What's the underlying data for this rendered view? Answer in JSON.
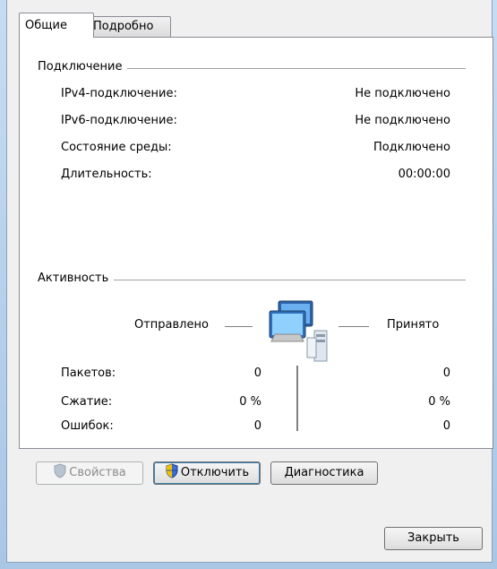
{
  "tabs": [
    {
      "label": "Общие",
      "active": true
    },
    {
      "label": "Подробно",
      "active": false
    }
  ],
  "connection": {
    "title": "Подключение",
    "rows": [
      {
        "label": "IPv4-подключение:",
        "value": "Не подключено"
      },
      {
        "label": "IPv6-подключение:",
        "value": "Не подключено"
      },
      {
        "label": "Состояние среды:",
        "value": "Подключено"
      },
      {
        "label": "Длительность:",
        "value": "00:00:00"
      }
    ]
  },
  "activity": {
    "title": "Активность",
    "sent_label": "Отправлено",
    "received_label": "Принято",
    "rows": [
      {
        "label": "Пакетов:",
        "sent": "0",
        "received": "0"
      },
      {
        "label": "Сжатие:",
        "sent": "0 %",
        "received": "0 %"
      },
      {
        "label": "Ошибок:",
        "sent": "0",
        "received": "0"
      }
    ]
  },
  "buttons": {
    "properties": "Свойства",
    "disable": "Отключить",
    "diagnose": "Диагностика",
    "close": "Закрыть"
  },
  "icons": {
    "network": "network-computers-icon",
    "shield": "uac-shield-icon"
  }
}
